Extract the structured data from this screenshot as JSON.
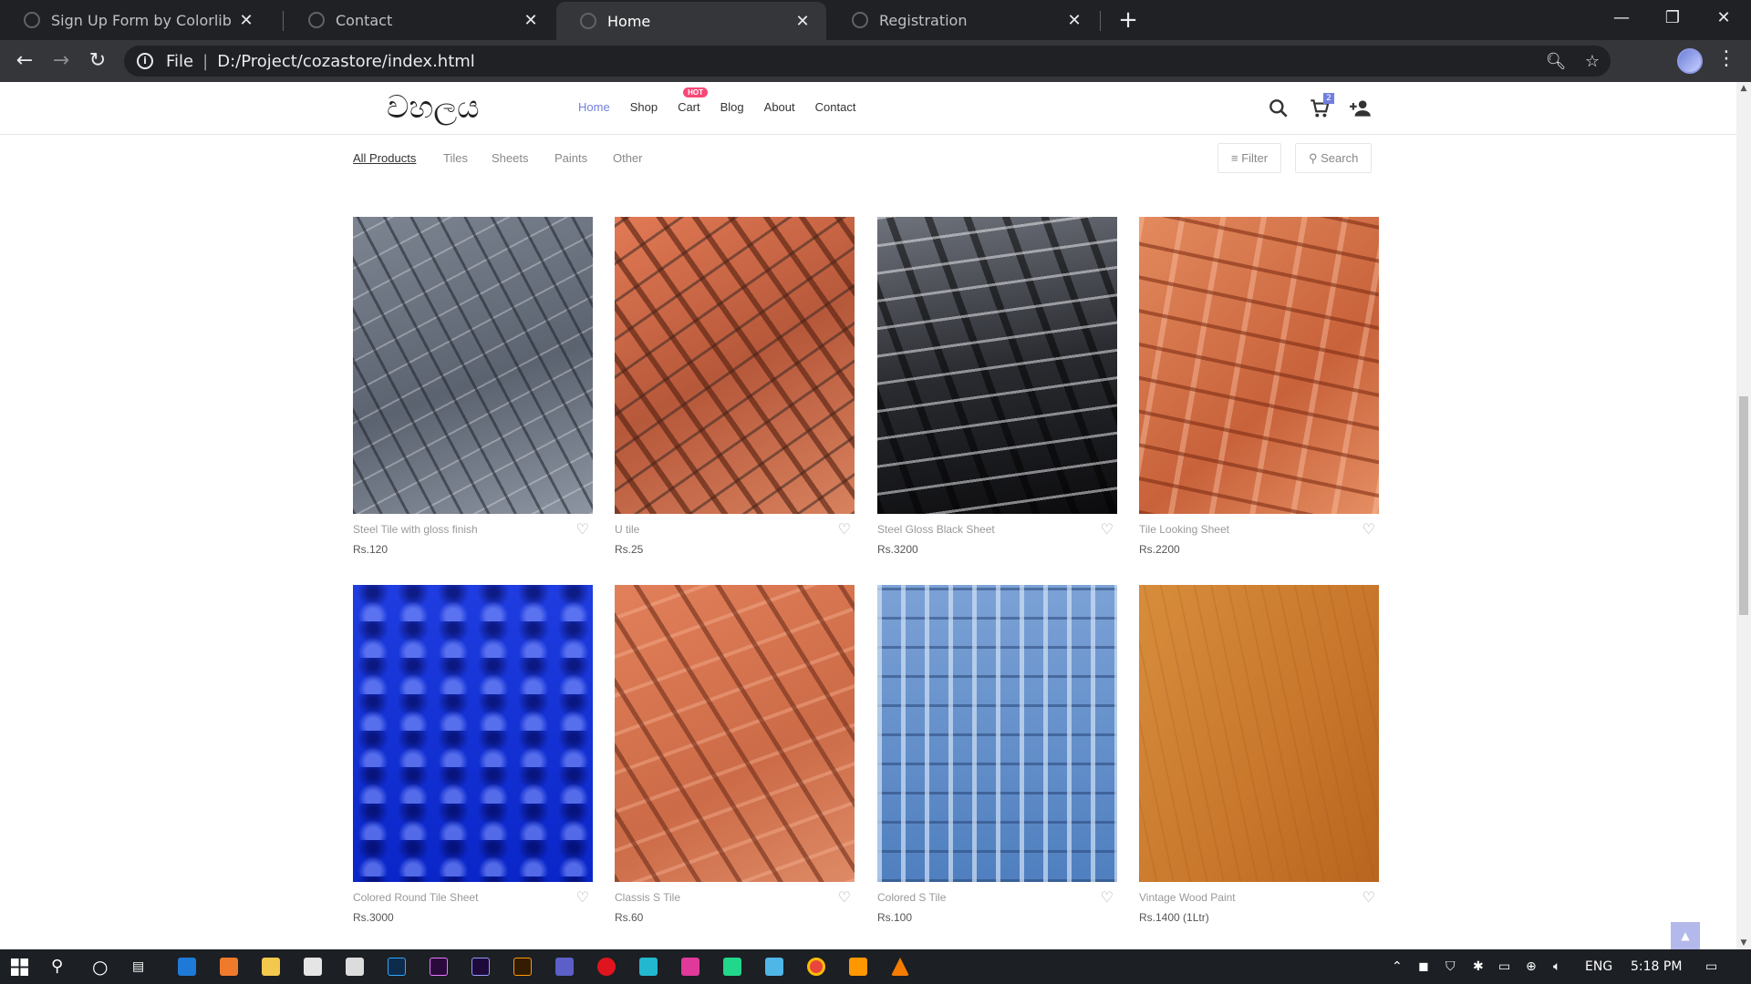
{
  "browser": {
    "tabs": [
      {
        "label": "Sign Up Form by Colorlib"
      },
      {
        "label": "Contact"
      },
      {
        "label": "Home"
      },
      {
        "label": "Registration"
      }
    ],
    "url_scheme": "File",
    "url": "D:/Project/cozastore/index.html"
  },
  "site": {
    "logo": "වහලය",
    "nav": [
      {
        "label": "Home"
      },
      {
        "label": "Shop"
      },
      {
        "label": "Cart"
      },
      {
        "label": "Blog"
      },
      {
        "label": "About"
      },
      {
        "label": "Contact"
      }
    ],
    "hot_badge": "HOT",
    "cart_count": "2",
    "accent_color": "#717fe0"
  },
  "filters": {
    "categories": [
      "All Products",
      "Tiles",
      "Sheets",
      "Paints",
      "Other"
    ],
    "filter_label": "Filter",
    "search_label": "Search"
  },
  "products": [
    {
      "name": "Steel Tile with gloss finish",
      "price": "Rs.120"
    },
    {
      "name": "U tile",
      "price": "Rs.25"
    },
    {
      "name": "Steel Gloss Black Sheet",
      "price": "Rs.3200"
    },
    {
      "name": "Tile Looking Sheet",
      "price": "Rs.2200"
    },
    {
      "name": "Colored Round Tile Sheet",
      "price": "Rs.3000"
    },
    {
      "name": "Classis S Tile",
      "price": "Rs.60"
    },
    {
      "name": "Colored S Tile",
      "price": "Rs.100"
    },
    {
      "name": "Vintage Wood Paint",
      "price": "Rs.1400 (1Ltr)"
    }
  ],
  "taskbar": {
    "language": "ENG",
    "time": "5:18 PM"
  }
}
